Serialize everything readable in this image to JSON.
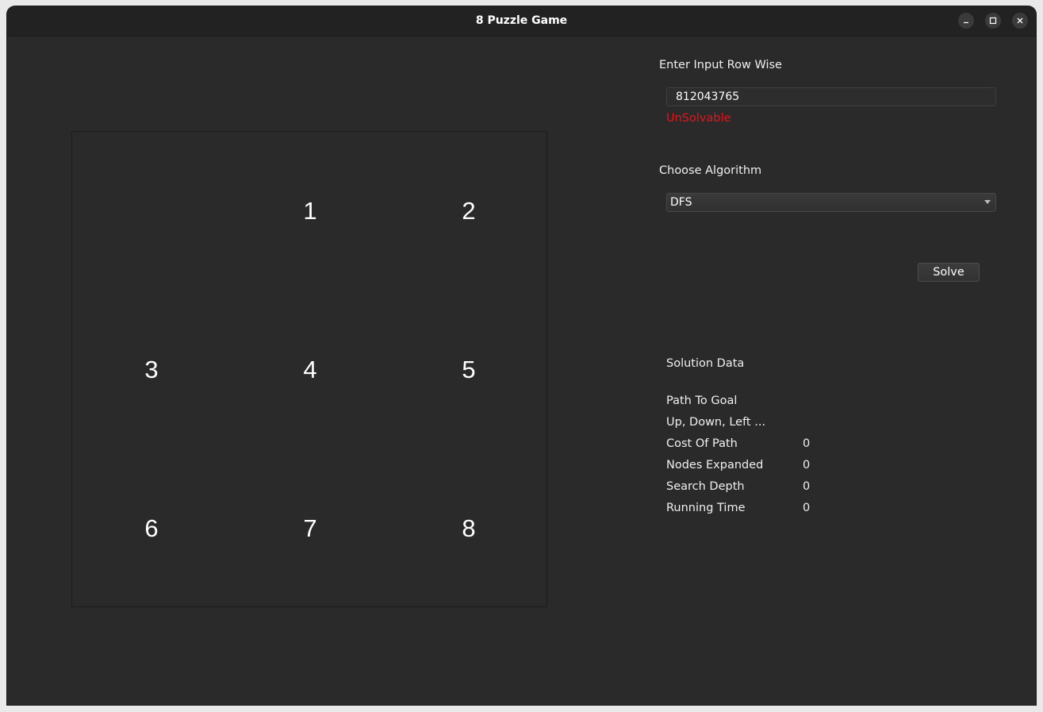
{
  "window": {
    "title": "8 Puzzle Game",
    "controls": {
      "minimize": "minimize-icon",
      "maximize": "maximize-icon",
      "close": "close-icon"
    }
  },
  "puzzle": {
    "tiles": [
      "",
      "1",
      "2",
      "3",
      "4",
      "5",
      "6",
      "7",
      "8"
    ]
  },
  "input": {
    "label": "Enter Input Row Wise",
    "value": "812043765",
    "status": "UnSolvable",
    "status_color": "#e0161d"
  },
  "algorithm": {
    "label": "Choose Algorithm",
    "selected": "DFS"
  },
  "solve_button": "Solve",
  "solution": {
    "title": "Solution Data",
    "path_label": "Path To Goal",
    "path_value": "Up, Down, Left ...",
    "rows": [
      {
        "label": "Cost Of Path",
        "value": "0"
      },
      {
        "label": "Nodes Expanded",
        "value": "0"
      },
      {
        "label": "Search Depth",
        "value": "0"
      },
      {
        "label": "Running Time",
        "value": "0"
      }
    ]
  }
}
